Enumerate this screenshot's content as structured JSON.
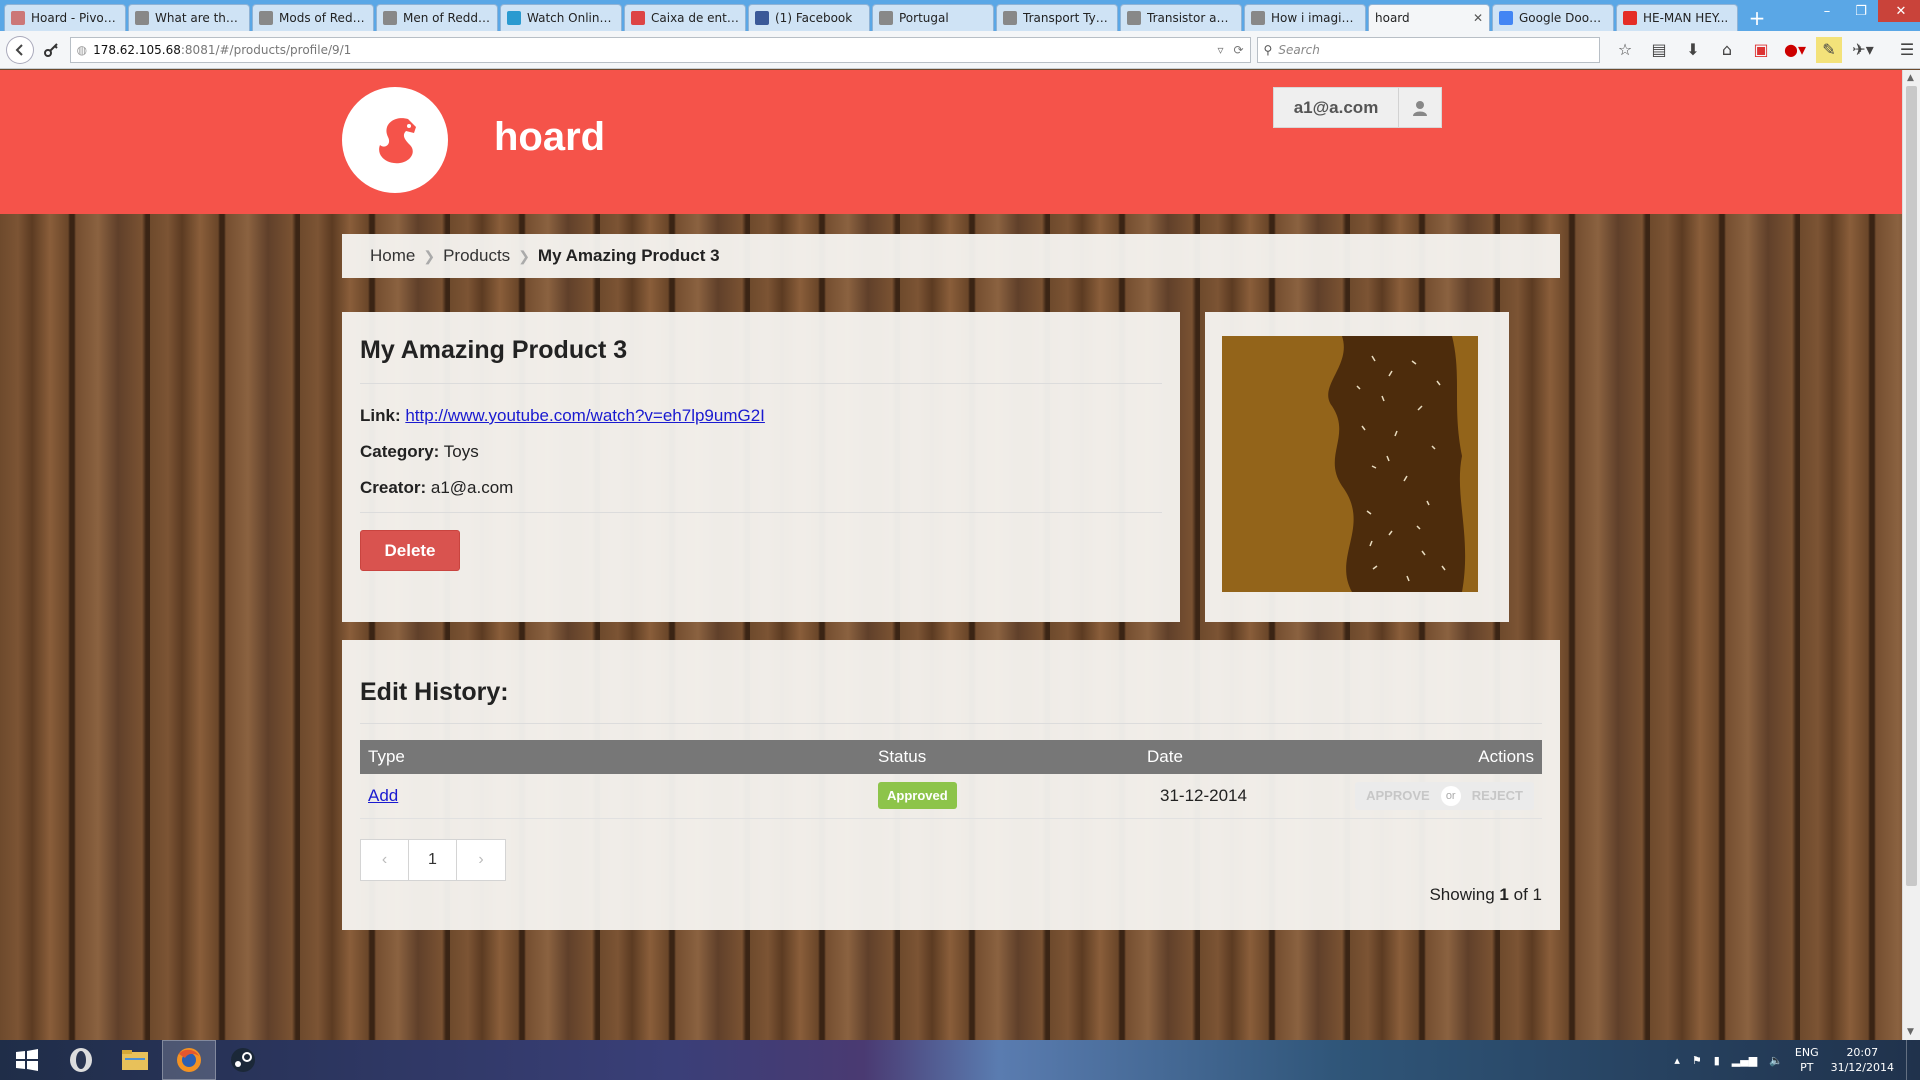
{
  "browser": {
    "tabs": [
      {
        "title": "Hoard - Pivot...",
        "icon": "site-icon",
        "color": "#c77"
      },
      {
        "title": "What are the ...",
        "icon": "reddit-icon",
        "color": "#888"
      },
      {
        "title": "Mods of Redd...",
        "icon": "reddit-icon",
        "color": "#888"
      },
      {
        "title": "Men of Reddi...",
        "icon": "reddit-icon",
        "color": "#888"
      },
      {
        "title": "Watch Online...",
        "icon": "cube-icon",
        "color": "#2a9ad0"
      },
      {
        "title": "Caixa de entra...",
        "icon": "gmail-icon",
        "color": "#d44"
      },
      {
        "title": "(1) Facebook",
        "icon": "facebook-icon",
        "color": "#3b5998"
      },
      {
        "title": "Portugal",
        "icon": "reddit-icon",
        "color": "#888"
      },
      {
        "title": "Transport Tyc...",
        "icon": "reddit-icon",
        "color": "#888"
      },
      {
        "title": "Transistor an...",
        "icon": "reddit-icon",
        "color": "#888"
      },
      {
        "title": "How i imagin...",
        "icon": "reddit-icon",
        "color": "#888"
      },
      {
        "title": "hoard",
        "icon": "none",
        "color": "transparent",
        "active": true
      },
      {
        "title": "Google Doodl...",
        "icon": "google-icon",
        "color": "#4285f4"
      },
      {
        "title": "HE-MAN HEY...",
        "icon": "youtube-icon",
        "color": "#e52d27"
      }
    ],
    "url_host": "178.62.105.68",
    "url_path": ":8081/#/products/profile/9/1",
    "search_placeholder": "Search"
  },
  "app": {
    "brand": "hoard",
    "user_email": "a1@a.com",
    "accent_color": "#f5534a"
  },
  "breadcrumb": {
    "items": [
      "Home",
      "Products"
    ],
    "current": "My Amazing Product 3"
  },
  "product": {
    "title": "My Amazing Product 3",
    "link_label": "Link:",
    "link_value": "http://www.youtube.com/watch?v=eh7lp9umG2I",
    "category_label": "Category:",
    "category_value": "Toys",
    "creator_label": "Creator:",
    "creator_value": "a1@a.com",
    "delete_label": "Delete"
  },
  "history": {
    "title": "Edit History:",
    "columns": [
      "Type",
      "Status",
      "Date",
      "Actions"
    ],
    "rows": [
      {
        "type": "Add",
        "status": "Approved",
        "date": "31-12-2014",
        "approve": "APPROVE",
        "or": "or",
        "reject": "REJECT"
      }
    ],
    "pager": {
      "prev": "‹",
      "page": "1",
      "next": "›"
    },
    "showing_prefix": "Showing",
    "showing_current": "1",
    "showing_sep": "of",
    "showing_total": "1"
  },
  "taskbar": {
    "lang_top": "ENG",
    "lang_bottom": "PT",
    "time": "20:07",
    "date": "31/12/2014"
  }
}
